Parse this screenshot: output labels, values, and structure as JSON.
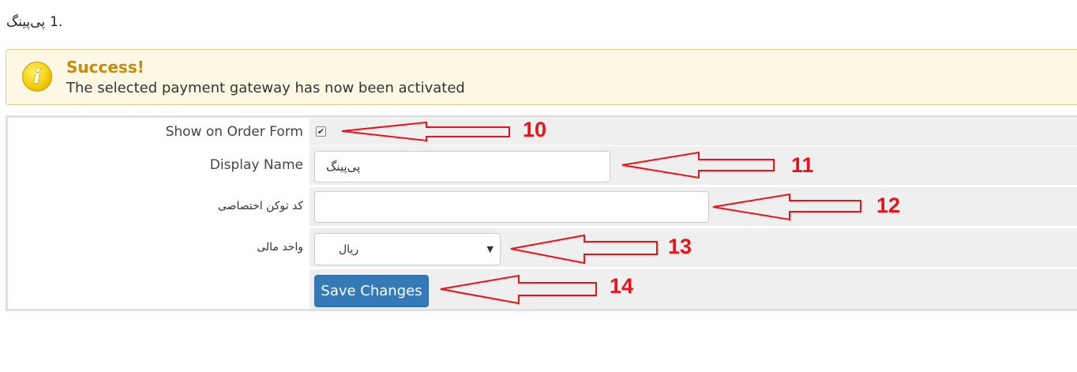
{
  "heading": {
    "number": "1.",
    "title": "پی‌پینگ"
  },
  "alert": {
    "icon": "info-icon",
    "title": "Success!",
    "message": "The selected payment gateway has now been activated",
    "colors": {
      "background": "#fcf8e3",
      "title": "#c98a06"
    }
  },
  "form": {
    "show_on_order_form": {
      "label": "Show on Order Form",
      "checked": true
    },
    "display_name": {
      "label": "Display Name",
      "value": "پی‌پینگ"
    },
    "token": {
      "label": "کد توکن اختصاصی",
      "value": ""
    },
    "currency": {
      "label": "واحد مالی",
      "selected": "ریال"
    },
    "save_label": "Save Changes"
  },
  "annotations": [
    "10",
    "11",
    "12",
    "13",
    "14"
  ],
  "colors": {
    "accent": "#337ab7",
    "annotation": "#e8141c"
  }
}
